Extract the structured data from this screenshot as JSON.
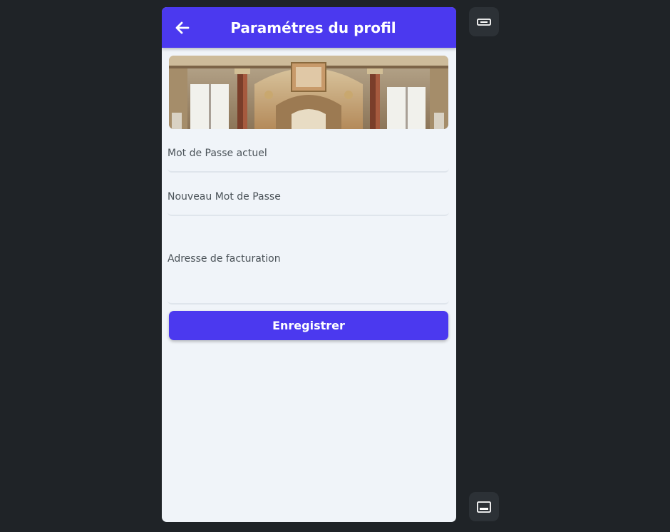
{
  "appbar": {
    "title": "Paramétres du profil",
    "back_icon": "arrow-left-icon"
  },
  "hero": {
    "image": "baroque-hall-ceiling-photo"
  },
  "form": {
    "current_password_label": "Mot de Passe actuel",
    "current_password_value": "",
    "new_password_label": "Nouveau Mot de Passe",
    "new_password_value": "",
    "billing_address_label": "Adresse de facturation",
    "billing_address_value": ""
  },
  "save_label": "Enregistrer",
  "side_controls": {
    "top_icon": "rotate-device-icon",
    "bottom_icon": "keyboard-toggle-icon"
  },
  "colors": {
    "primary": "#4b39ef",
    "page_background": "#f0f4f9",
    "canvas_background": "#1f2327"
  }
}
